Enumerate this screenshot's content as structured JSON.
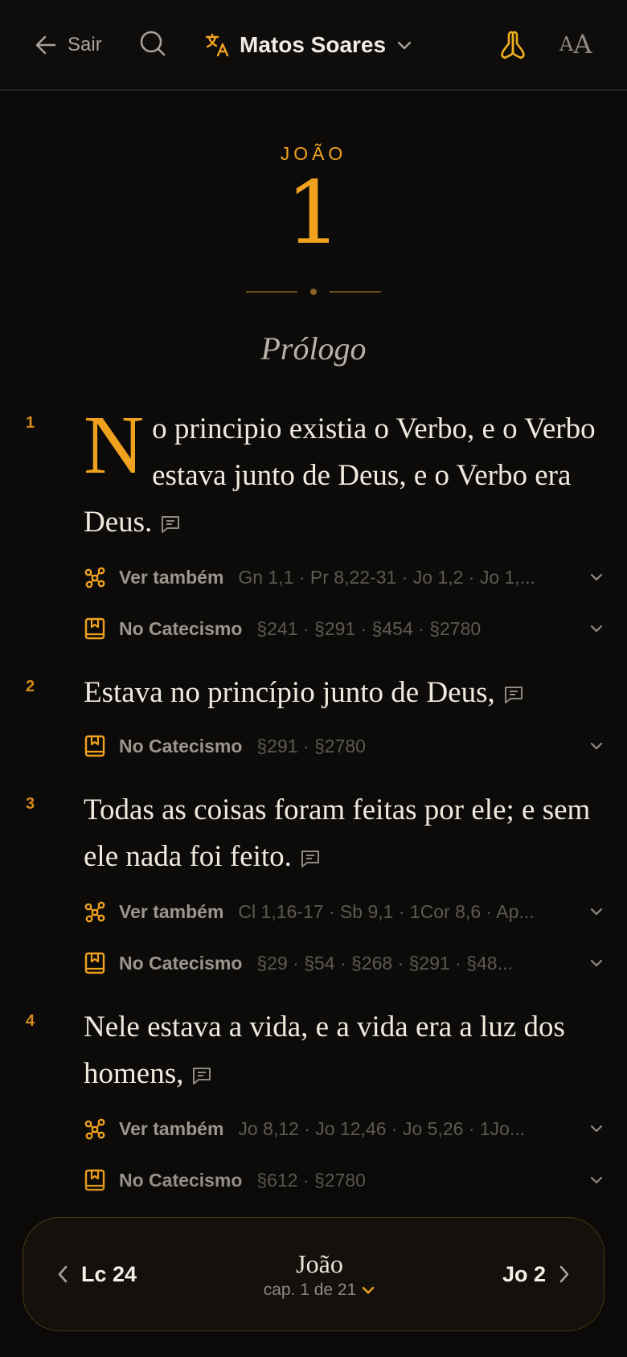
{
  "header": {
    "back_label": "Sair",
    "translation_name": "Matos Soares",
    "font_size_small": "A",
    "font_size_large": "A"
  },
  "chapter": {
    "book": "JOÃO",
    "number": "1",
    "pericope": "Prólogo"
  },
  "labels": {
    "see_also": "Ver também",
    "catechism": "No Catecismo"
  },
  "verses": [
    {
      "number": "1",
      "drop_cap": "N",
      "text": "o principio existia o Verbo, e o Verbo estava junto de Deus, e o Verbo era Deus.",
      "see_also": "Gn 1,1 · Pr 8,22-31 · Jo 1,2 · Jo 1,...",
      "catechism": "§241 · §291 · §454 · §2780"
    },
    {
      "number": "2",
      "text": "Estava no princípio junto de Deus,",
      "catechism": "§291 · §2780"
    },
    {
      "number": "3",
      "text": "Todas as coisas foram feitas por ele; e sem ele nada foi feito.",
      "see_also": "Cl 1,16-17 · Sb 9,1 · 1Cor 8,6 · Ap...",
      "catechism": "§29 · §54 · §268 · §291 · §48..."
    },
    {
      "number": "4",
      "text": "Nele estava a vida, e a vida era a luz dos homens,",
      "see_also": "Jo 8,12 · Jo 12,46 · Jo 5,26 · 1Jo...",
      "catechism": "§612 · §2780"
    }
  ],
  "bottom_nav": {
    "prev": "Lc 24",
    "book": "João",
    "chapter_info": "cap. 1 de 21",
    "next": "Jo 2"
  },
  "colors": {
    "accent": "#f0a21f",
    "background": "#0c0b0a",
    "text": "#efe9de"
  }
}
